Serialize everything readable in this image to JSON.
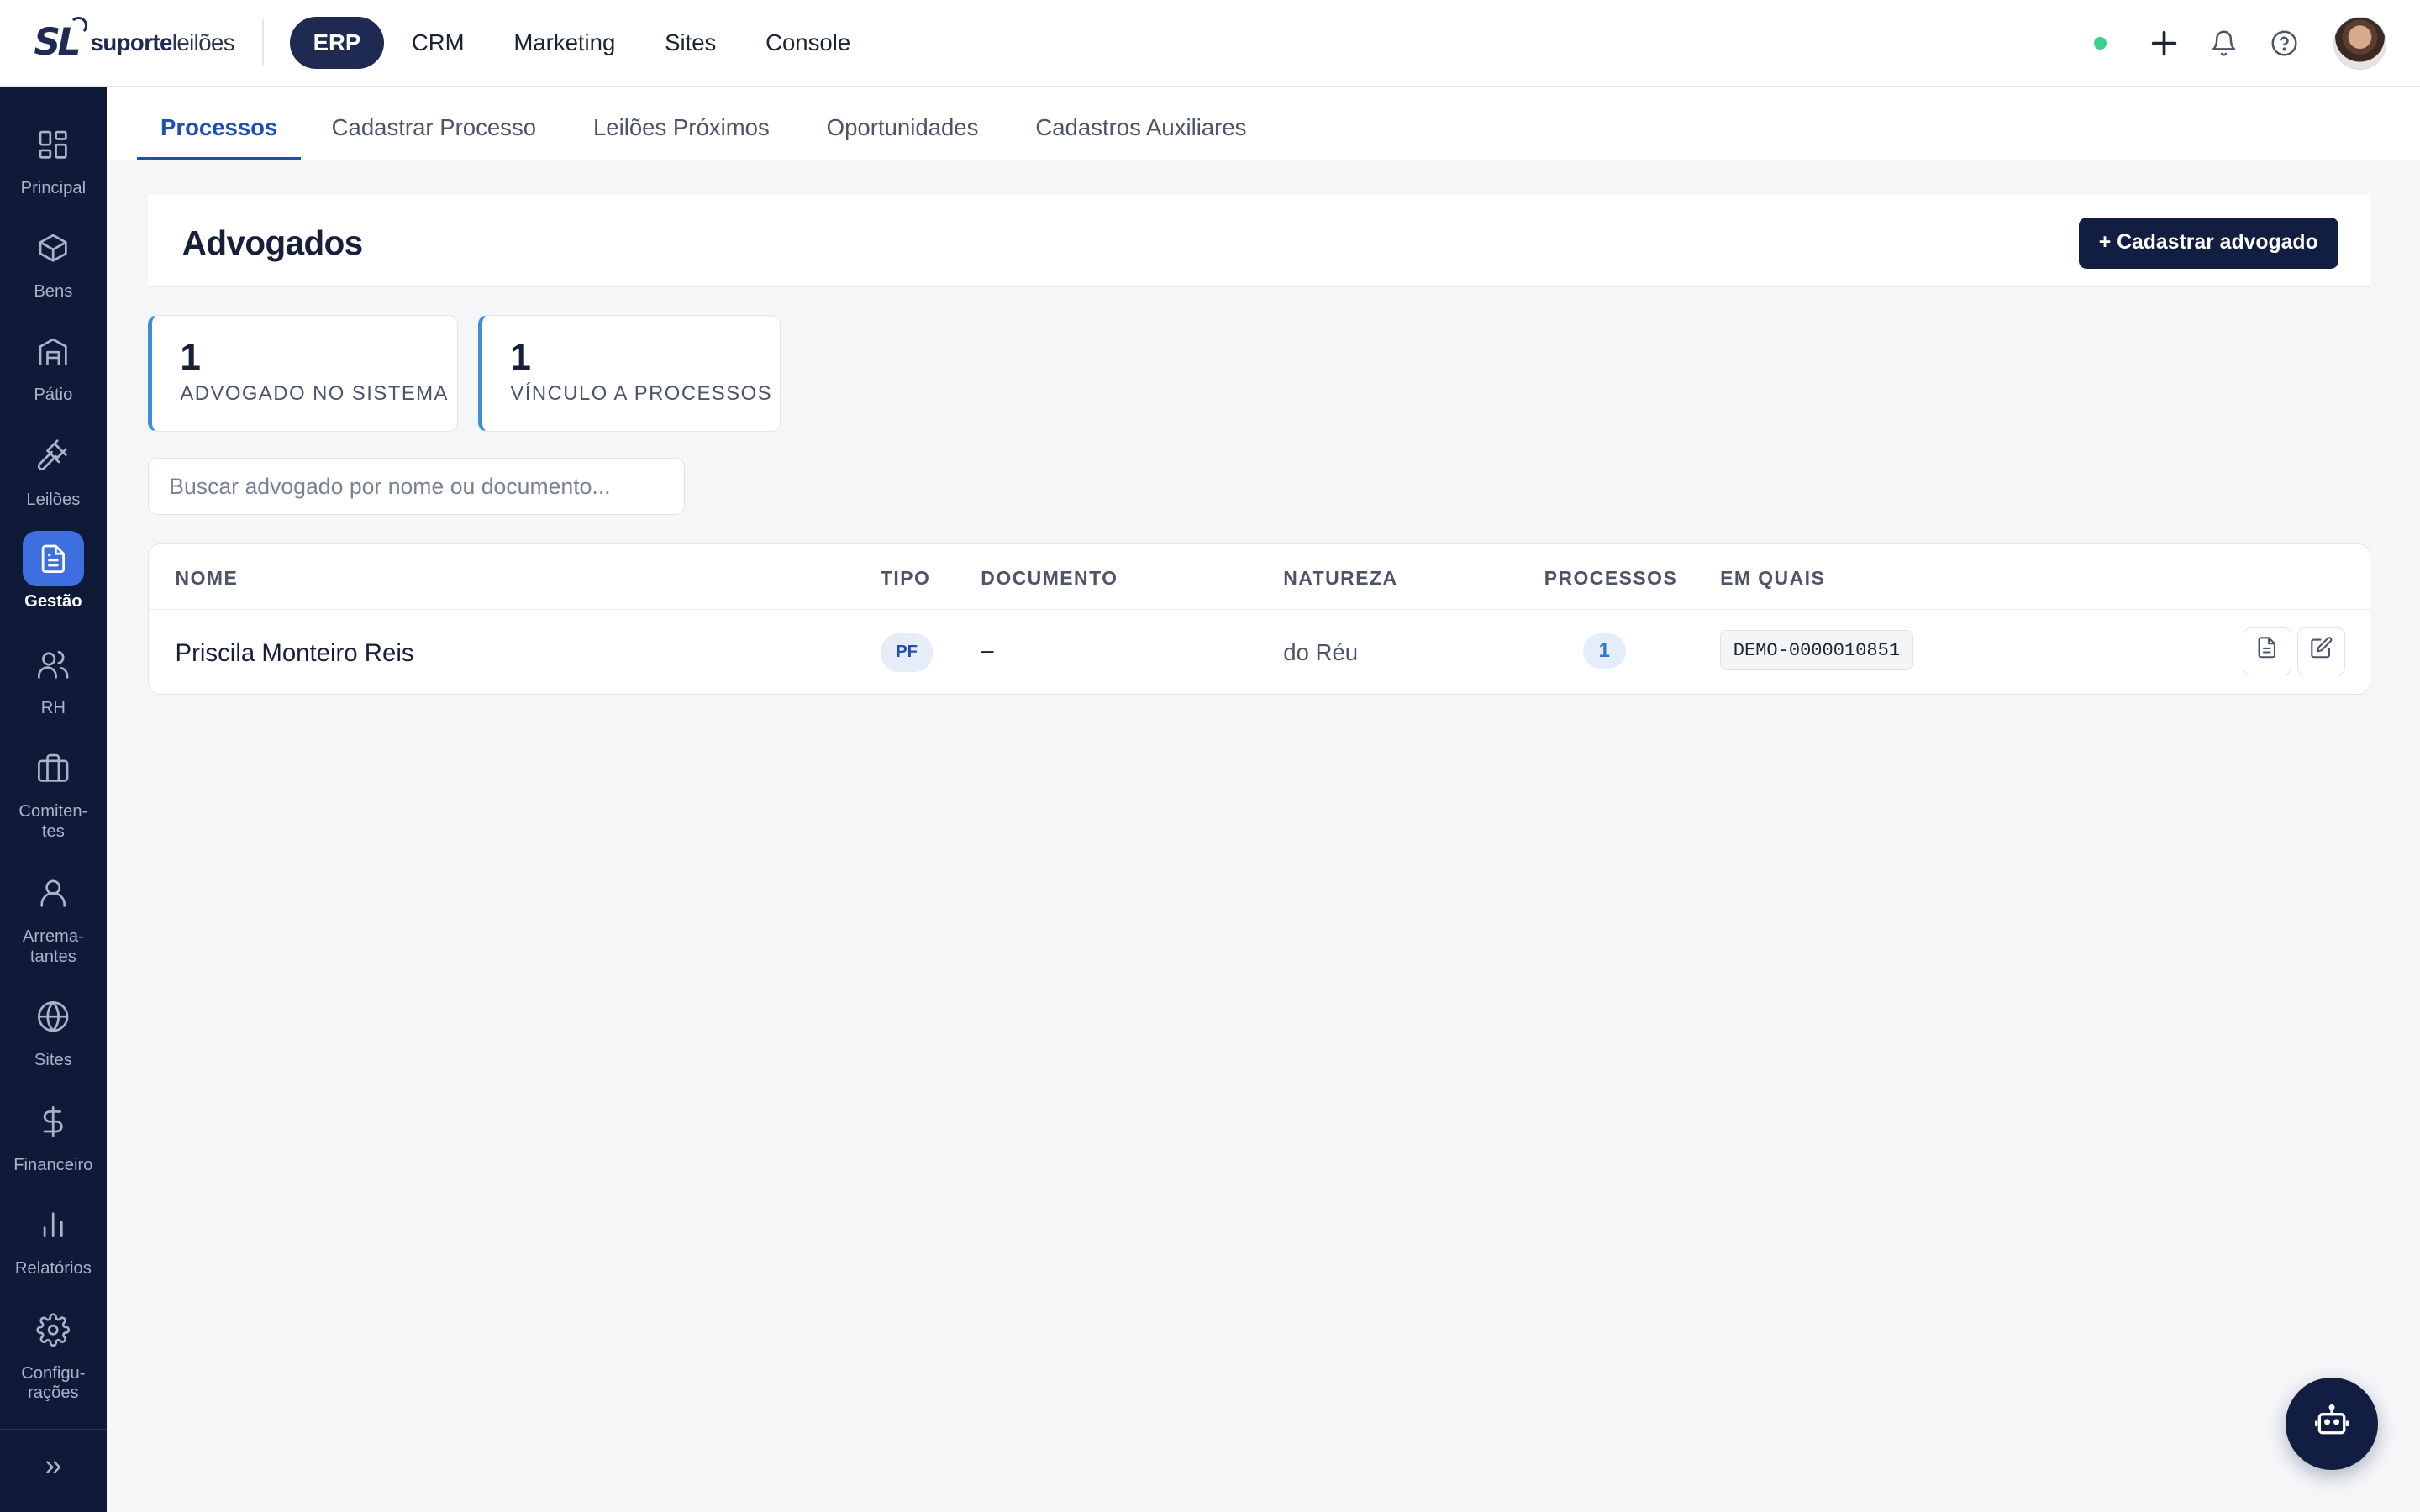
{
  "brand": {
    "mark": "SL",
    "name_bold": "suporte",
    "name_light": "leilões"
  },
  "topnav": [
    {
      "label": "ERP",
      "active": true
    },
    {
      "label": "CRM"
    },
    {
      "label": "Marketing"
    },
    {
      "label": "Sites"
    },
    {
      "label": "Console"
    }
  ],
  "topright": {
    "status_color": "#3ecf8e",
    "icons": [
      "plus-icon",
      "bell-icon",
      "help-icon",
      "avatar"
    ]
  },
  "sidebar": {
    "items": [
      {
        "label": "Principal",
        "icon": "grid-icon"
      },
      {
        "label": "Bens",
        "icon": "box-icon"
      },
      {
        "label": "Pátio",
        "icon": "warehouse-icon"
      },
      {
        "label": "Leilões",
        "icon": "gavel-icon"
      },
      {
        "label": "Gestão",
        "icon": "document-icon",
        "active": true
      },
      {
        "label": "RH",
        "icon": "users-icon"
      },
      {
        "label": "Comiten-\ntes",
        "icon": "briefcase-icon"
      },
      {
        "label": "Arrema-\ntantes",
        "icon": "user-icon"
      },
      {
        "label": "Sites",
        "icon": "globe-icon"
      },
      {
        "label": "Financeiro",
        "icon": "dollar-icon"
      },
      {
        "label": "Relatórios",
        "icon": "bar-chart-icon"
      },
      {
        "label": "Configu-\nrações",
        "icon": "gear-icon"
      }
    ],
    "toggle_icon": "chevrons-right-icon"
  },
  "tabs": [
    {
      "label": "Processos",
      "active": true
    },
    {
      "label": "Cadastrar Processo"
    },
    {
      "label": "Leilões Próximos"
    },
    {
      "label": "Oportunidades"
    },
    {
      "label": "Cadastros Auxiliares"
    }
  ],
  "page": {
    "title": "Advogados",
    "add_button": "+ Cadastrar advogado"
  },
  "stats": [
    {
      "value": "1",
      "label": "ADVOGADO NO SISTEMA"
    },
    {
      "value": "1",
      "label": "VÍNCULO A PROCESSOS"
    }
  ],
  "search": {
    "placeholder": "Buscar advogado por nome ou documento...",
    "value": ""
  },
  "table": {
    "columns": [
      "NOME",
      "TIPO",
      "DOCUMENTO",
      "NATUREZA",
      "PROCESSOS",
      "EM QUAIS"
    ],
    "rows": [
      {
        "nome": "Priscila Monteiro Reis",
        "tipo": "PF",
        "documento": "–",
        "natureza": "do Réu",
        "processos": "1",
        "em_quais": "DEMO-0000010851"
      }
    ]
  },
  "colors": {
    "accent": "#1f4fb4",
    "navy": "#121d42",
    "sidebar_bg": "#0e1a38",
    "active_item": "#3d6fe0",
    "stat_border": "#3f8ed9"
  }
}
